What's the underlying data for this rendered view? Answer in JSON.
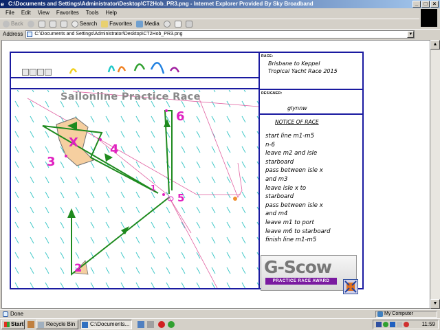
{
  "window": {
    "title": "C:\\Documents and Settings\\Administrator\\Desktop\\CT2Hob_PR3.png - Internet Explorer Provided By Sky Broadband",
    "controls": {
      "minimize": "_",
      "maximize": "□",
      "close": "×"
    }
  },
  "menu": [
    "File",
    "Edit",
    "View",
    "Favorites",
    "Tools",
    "Help"
  ],
  "toolbar": {
    "back": "Back",
    "search": "Search",
    "favorites": "Favorites",
    "media": "Media"
  },
  "address": {
    "label": "Address",
    "value": "C:\\Documents and Settings\\Administrator\\Desktop\\CT2Hob_PR3.png"
  },
  "race": {
    "banner": "Sailonline Practice Race",
    "race_label": "RACE:",
    "race_name_line1": "Brisbane to Keppel",
    "race_name_line2": "Tropical Yacht Race 2015",
    "designer_label": "DESIGNER:",
    "designer": "glynnw",
    "notice_title": "NOTICE OF RACE",
    "notice_lines": [
      "start line m1-m5",
      "n-6",
      "leave m2 and isle",
      "starboard",
      "pass between isle x",
      "and m3",
      "leave isle x to",
      "starboard",
      "pass between isle x",
      "and m4",
      "leave m1 to port",
      "leave m6 to starboard",
      "finish line m1-m5"
    ],
    "marks": [
      "1",
      "2",
      "3",
      "4",
      "5",
      "6",
      "X"
    ],
    "logo_title": "G-Scow",
    "logo_subtitle": "PRACTICE RACE AWARD",
    "colors": {
      "frame": "#1a1aa0",
      "course": "#1e8a1e",
      "marks": "#e020c0",
      "wind": "#40c8c8"
    }
  },
  "status": {
    "text": "Done",
    "zone": "My Computer"
  },
  "taskbar": {
    "start": "Start",
    "items": [
      "Recycle Bin",
      "C:\\Documents..."
    ],
    "clock": "11:59"
  }
}
